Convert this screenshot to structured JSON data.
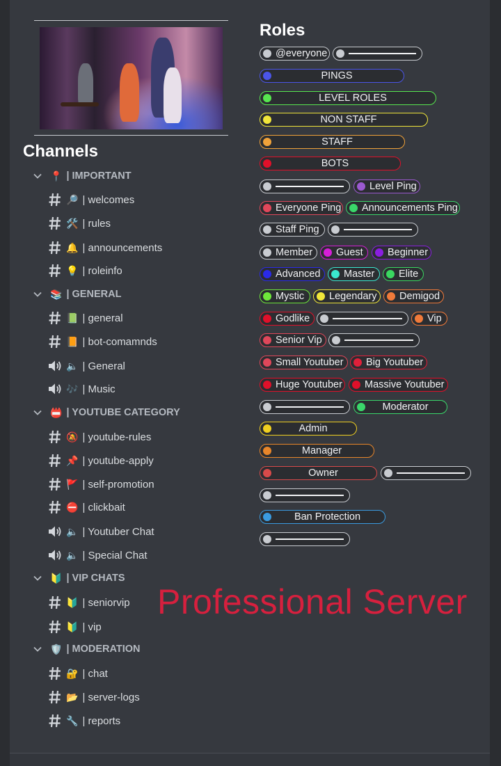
{
  "channels_title": "Channels",
  "roles_title": "Roles",
  "watermark": "Professional Server",
  "caption": "",
  "categories": [
    {
      "label": "IMPORTANT",
      "emoji": "📍"
    },
    {
      "label": "GENERAL",
      "emoji": "📚"
    },
    {
      "label": "YOUTUBE CATEGORY",
      "emoji": "📛"
    },
    {
      "label": "VIP CHATS",
      "emoji": "🔰"
    },
    {
      "label": "MODERATION",
      "emoji": "🛡️"
    }
  ],
  "channels": [
    {
      "name": "welcomes",
      "emoji": "🔎",
      "type": "text"
    },
    {
      "name": "rules",
      "emoji": "🛠️",
      "type": "text"
    },
    {
      "name": "announcements",
      "emoji": "🔔",
      "type": "text"
    },
    {
      "name": "roleinfo",
      "emoji": "💡",
      "type": "text"
    },
    {
      "name": "general",
      "emoji": "📗",
      "type": "text"
    },
    {
      "name": "bot-comamnds",
      "emoji": "📙",
      "type": "text"
    },
    {
      "name": "General",
      "emoji": "🔈",
      "type": "voice"
    },
    {
      "name": "Music",
      "emoji": "🎶",
      "type": "voice"
    },
    {
      "name": "youtube-rules",
      "emoji": "🔕",
      "type": "text"
    },
    {
      "name": "youtube-apply",
      "emoji": "📌",
      "type": "text"
    },
    {
      "name": "self-promotion",
      "emoji": "🚩",
      "type": "text"
    },
    {
      "name": "clickbait",
      "emoji": "⛔",
      "type": "text"
    },
    {
      "name": "Youtuber Chat",
      "emoji": "🔈",
      "type": "voice"
    },
    {
      "name": "Special Chat",
      "emoji": "🔈",
      "type": "voice"
    },
    {
      "name": "seniorvip",
      "emoji": "🔰",
      "type": "text"
    },
    {
      "name": "vip",
      "emoji": "🔰",
      "type": "text"
    },
    {
      "name": "chat",
      "emoji": "🔐",
      "type": "text"
    },
    {
      "name": "server-logs",
      "emoji": "📂",
      "type": "text"
    },
    {
      "name": "reports",
      "emoji": "🔧",
      "type": "text"
    }
  ],
  "channel_prefix": "|",
  "roles": [
    {
      "label": "@everyone",
      "color": "#c9ccd1"
    },
    {
      "label": "PINGS",
      "color": "#4b55e8"
    },
    {
      "label": "LEVEL ROLES",
      "color": "#57e64f"
    },
    {
      "label": "NON STAFF",
      "color": "#f0e63a"
    },
    {
      "label": "STAFF",
      "color": "#f0a23a"
    },
    {
      "label": "BOTS",
      "color": "#e0102a"
    },
    {
      "label": "Level Ping",
      "color": "#9b59d0"
    },
    {
      "label": "Everyone Ping",
      "color": "#e0475a"
    },
    {
      "label": "Announcements Ping",
      "color": "#3ad76a"
    },
    {
      "label": "Staff Ping",
      "color": "#c9ccd1"
    },
    {
      "label": "Member",
      "color": "#c9ccd1"
    },
    {
      "label": "Guest",
      "color": "#d61ed8"
    },
    {
      "label": "Beginner",
      "color": "#8a1ee0"
    },
    {
      "label": "Advanced",
      "color": "#2a2ae8"
    },
    {
      "label": "Master",
      "color": "#3ae8d0"
    },
    {
      "label": "Elite",
      "color": "#3ad760"
    },
    {
      "label": "Mystic",
      "color": "#6ee83a"
    },
    {
      "label": "Legendary",
      "color": "#f0e63a"
    },
    {
      "label": "Demigod",
      "color": "#f07a3a"
    },
    {
      "label": "Godlike",
      "color": "#e0102a"
    },
    {
      "label": "Vip",
      "color": "#f07a3a"
    },
    {
      "label": "Senior Vip",
      "color": "#e0475a"
    },
    {
      "label": "Small Youtuber",
      "color": "#e0475a"
    },
    {
      "label": "Big Youtuber",
      "color": "#e0203a"
    },
    {
      "label": "Huge Youtuber",
      "color": "#e0102a"
    },
    {
      "label": "Massive Youtuber",
      "color": "#e0102a"
    },
    {
      "label": "Moderator",
      "color": "#3ad76a"
    },
    {
      "label": "Admin",
      "color": "#f0d020"
    },
    {
      "label": "Manager",
      "color": "#e8862a"
    },
    {
      "label": "Owner",
      "color": "#d84a4a"
    },
    {
      "label": "Ban Protection",
      "color": "#3a9be0"
    }
  ],
  "separator_color": "#c9ccd1"
}
